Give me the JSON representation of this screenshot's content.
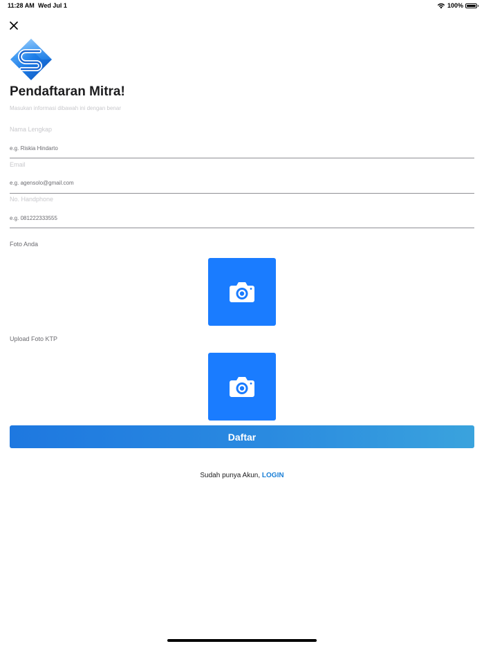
{
  "status_bar": {
    "time": "11:28 AM",
    "date": "Wed Jul 1",
    "battery": "100%",
    "battery_level": 1.0
  },
  "header": {
    "title": "Pendaftaran Mitra!",
    "subtitle": "Masukan informasi dibawah ini dengan benar"
  },
  "form": {
    "fields": [
      {
        "label": "Nama Lengkap",
        "placeholder": "e.g. Riskia Hindarto"
      },
      {
        "label": "Email",
        "placeholder": "e.g. agensolo@gmail.com"
      },
      {
        "label": "No. Handphone",
        "placeholder": "e.g. 081222333555"
      }
    ],
    "photo_label": "Foto Anda",
    "ktp_label": "Upload Foto KTP",
    "submit_label": "Daftar"
  },
  "footer": {
    "prompt": "Sudah punya Akun, ",
    "login_label": "LOGIN"
  },
  "colors": {
    "accent": "#1a7cff",
    "link": "#1a7fd6",
    "button_gradient_start": "#1e78e0",
    "button_gradient_end": "#3aa3dd"
  },
  "icons": {
    "close": "close-icon",
    "photo_upload": "camera-icon",
    "ktp_upload": "camera-icon",
    "wifi": "wifi-icon",
    "battery": "battery-icon"
  }
}
